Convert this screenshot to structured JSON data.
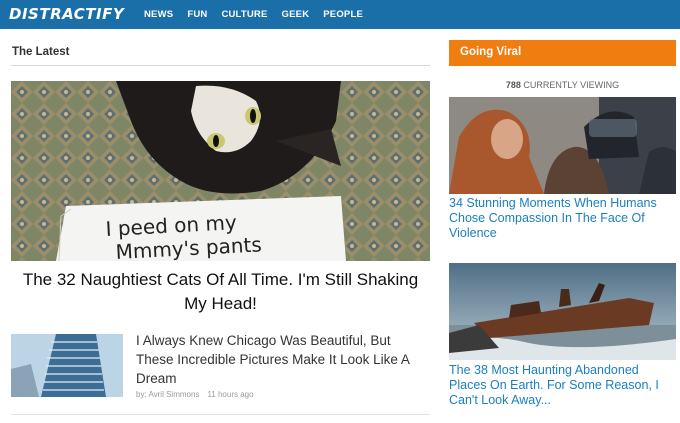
{
  "header": {
    "logo": "DISTRACTIFY",
    "nav": [
      "NEWS",
      "FUN",
      "CULTURE",
      "GEEK",
      "PEOPLE"
    ]
  },
  "latest": {
    "title": "The Latest",
    "hero": {
      "sign_line1": "I peed on my",
      "sign_line2": "Mmmy's pants",
      "title": "The 32 Naughtiest Cats Of All Time. I'm Still Shaking My Head!"
    },
    "article": {
      "title": "I Always Knew Chicago Was Beautiful, But These Incredible Pictures Make It Look Like A Dream",
      "author": "by: Avril Simmons",
      "time": "11 hours ago"
    }
  },
  "viral": {
    "title": "Going Viral",
    "viewing_count": "788",
    "viewing_label": "CURRENTLY VIEWING",
    "items": [
      {
        "title": "34 Stunning Moments When Humans Chose Compassion In The Face Of Violence"
      },
      {
        "title": "The 38 Most Haunting Abandoned Places On Earth. For Some Reason, I Can't Look Away..."
      }
    ]
  },
  "colors": {
    "nav_bg": "#1a6fa8",
    "viral_header": "#ef7d10",
    "link_blue": "#1a7fc1"
  }
}
